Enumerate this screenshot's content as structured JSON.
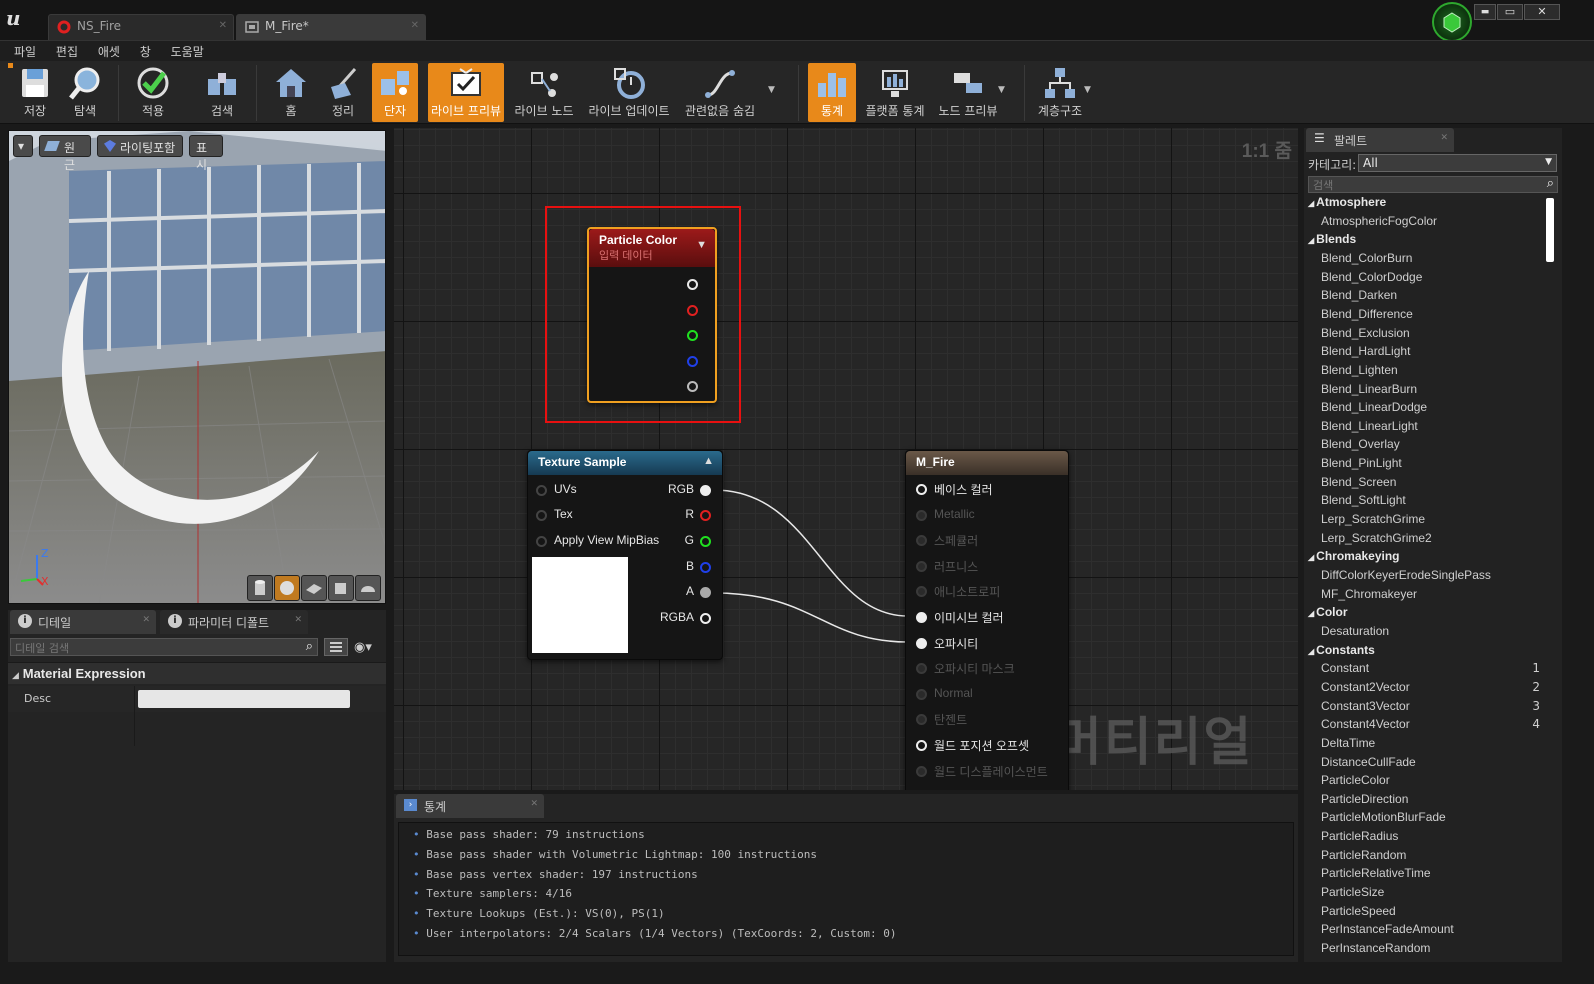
{
  "window": {
    "tabs": [
      {
        "label": "NS_Fire",
        "active": false
      },
      {
        "label": "M_Fire*",
        "active": true
      }
    ],
    "controls": {
      "minimize": "▬",
      "maximize": "▭",
      "close": "✕"
    }
  },
  "menu": [
    "파일",
    "편집",
    "애셋",
    "창",
    "도움말"
  ],
  "toolbar": {
    "buttons": [
      {
        "label": "저장",
        "icon": "save-icon",
        "active": false
      },
      {
        "label": "탐색",
        "icon": "browse-icon",
        "active": false
      },
      {
        "label": "적용",
        "icon": "apply-icon",
        "active": false
      },
      {
        "label": "검색",
        "icon": "search-icon",
        "active": false
      },
      {
        "label": "홈",
        "icon": "home-icon",
        "active": false
      },
      {
        "label": "정리",
        "icon": "clean-icon",
        "active": false
      },
      {
        "label": "단자",
        "icon": "connectors-icon",
        "active": true
      },
      {
        "label": "라이브 프리뷰",
        "icon": "live-preview-icon",
        "active": true
      },
      {
        "label": "라이브 노드",
        "icon": "live-nodes-icon",
        "active": false
      },
      {
        "label": "라이브 업데이트",
        "icon": "live-update-icon",
        "active": false
      },
      {
        "label": "관련없음 숨김",
        "icon": "hide-unrelated-icon",
        "active": false
      },
      {
        "label": "통계",
        "icon": "stats-icon",
        "active": true
      },
      {
        "label": "플랫폼 통계",
        "icon": "platform-stats-icon",
        "active": false
      },
      {
        "label": "노드 프리뷰",
        "icon": "node-preview-icon",
        "active": false
      },
      {
        "label": "계층구조",
        "icon": "hierarchy-icon",
        "active": false
      }
    ]
  },
  "viewport": {
    "buttons": {
      "dropdown": "▾",
      "perspective": "원근",
      "lighting": "라이팅포함",
      "show": "표시"
    },
    "axis": {
      "z": "Z",
      "x": "X"
    }
  },
  "details": {
    "tabs": [
      "디테일",
      "파라미터 디폴트"
    ],
    "search_placeholder": "디테일 검색",
    "section": "Material Expression",
    "property_label": "Desc",
    "property_value": ""
  },
  "graph": {
    "zoom": "1:1 줌",
    "watermark": "머티리얼",
    "particle_color_node": {
      "title": "Particle Color",
      "subtitle": "입력 데이터"
    },
    "texture_sample_node": {
      "title": "Texture Sample",
      "inputs": [
        "UVs",
        "Tex",
        "Apply View MipBias"
      ],
      "outputs": [
        "RGB",
        "R",
        "G",
        "B",
        "A",
        "RGBA"
      ]
    },
    "material_node": {
      "title": "M_Fire",
      "inputs": [
        {
          "label": "베이스 컬러",
          "enabled": true
        },
        {
          "label": "Metallic",
          "enabled": false
        },
        {
          "label": "스페큘러",
          "enabled": false
        },
        {
          "label": "러프니스",
          "enabled": false
        },
        {
          "label": "애니소트로피",
          "enabled": false
        },
        {
          "label": "이미시브 컬러",
          "enabled": true
        },
        {
          "label": "오파시티",
          "enabled": true
        },
        {
          "label": "오파시티 마스크",
          "enabled": false
        },
        {
          "label": "Normal",
          "enabled": false
        },
        {
          "label": "탄젠트",
          "enabled": false
        },
        {
          "label": "월드 포지션 오프셋",
          "enabled": true
        },
        {
          "label": "월드 디스플레이스먼트",
          "enabled": false
        }
      ]
    },
    "highlight_color": "#e81010",
    "node_selected_color": "#f0a020"
  },
  "stats": {
    "tab": "통계",
    "lines": [
      "Base pass shader: 79 instructions",
      "Base pass shader with Volumetric Lightmap: 100 instructions",
      "Base pass vertex shader: 197 instructions",
      "Texture samplers: 4/16",
      "Texture Lookups (Est.): VS(0), PS(1)",
      "User interpolators: 2/4 Scalars (1/4 Vectors) (TexCoords: 2, Custom: 0)"
    ]
  },
  "palette": {
    "tab": "팔레트",
    "category_label": "카테고리:",
    "category_value": "All",
    "search_placeholder": "검색",
    "entries": [
      {
        "type": "cat",
        "label": "Atmosphere"
      },
      {
        "type": "item",
        "label": "AtmosphericFogColor"
      },
      {
        "type": "cat",
        "label": "Blends"
      },
      {
        "type": "item",
        "label": "Blend_ColorBurn"
      },
      {
        "type": "item",
        "label": "Blend_ColorDodge"
      },
      {
        "type": "item",
        "label": "Blend_Darken"
      },
      {
        "type": "item",
        "label": "Blend_Difference"
      },
      {
        "type": "item",
        "label": "Blend_Exclusion"
      },
      {
        "type": "item",
        "label": "Blend_HardLight"
      },
      {
        "type": "item",
        "label": "Blend_Lighten"
      },
      {
        "type": "item",
        "label": "Blend_LinearBurn"
      },
      {
        "type": "item",
        "label": "Blend_LinearDodge"
      },
      {
        "type": "item",
        "label": "Blend_LinearLight"
      },
      {
        "type": "item",
        "label": "Blend_Overlay"
      },
      {
        "type": "item",
        "label": "Blend_PinLight"
      },
      {
        "type": "item",
        "label": "Blend_Screen"
      },
      {
        "type": "item",
        "label": "Blend_SoftLight"
      },
      {
        "type": "item",
        "label": "Lerp_ScratchGrime"
      },
      {
        "type": "item",
        "label": "Lerp_ScratchGrime2"
      },
      {
        "type": "cat",
        "label": "Chromakeying"
      },
      {
        "type": "item",
        "label": "DiffColorKeyerErodeSinglePass"
      },
      {
        "type": "item",
        "label": "MF_Chromakeyer"
      },
      {
        "type": "cat",
        "label": "Color"
      },
      {
        "type": "item",
        "label": "Desaturation"
      },
      {
        "type": "cat",
        "label": "Constants"
      },
      {
        "type": "item",
        "label": "Constant",
        "hotkey": "1"
      },
      {
        "type": "item",
        "label": "Constant2Vector",
        "hotkey": "2"
      },
      {
        "type": "item",
        "label": "Constant3Vector",
        "hotkey": "3"
      },
      {
        "type": "item",
        "label": "Constant4Vector",
        "hotkey": "4"
      },
      {
        "type": "item",
        "label": "DeltaTime"
      },
      {
        "type": "item",
        "label": "DistanceCullFade"
      },
      {
        "type": "item",
        "label": "ParticleColor"
      },
      {
        "type": "item",
        "label": "ParticleDirection"
      },
      {
        "type": "item",
        "label": "ParticleMotionBlurFade"
      },
      {
        "type": "item",
        "label": "ParticleRadius"
      },
      {
        "type": "item",
        "label": "ParticleRandom"
      },
      {
        "type": "item",
        "label": "ParticleRelativeTime"
      },
      {
        "type": "item",
        "label": "ParticleSize"
      },
      {
        "type": "item",
        "label": "ParticleSpeed"
      },
      {
        "type": "item",
        "label": "PerInstanceFadeAmount"
      },
      {
        "type": "item",
        "label": "PerInstanceRandom"
      }
    ]
  }
}
